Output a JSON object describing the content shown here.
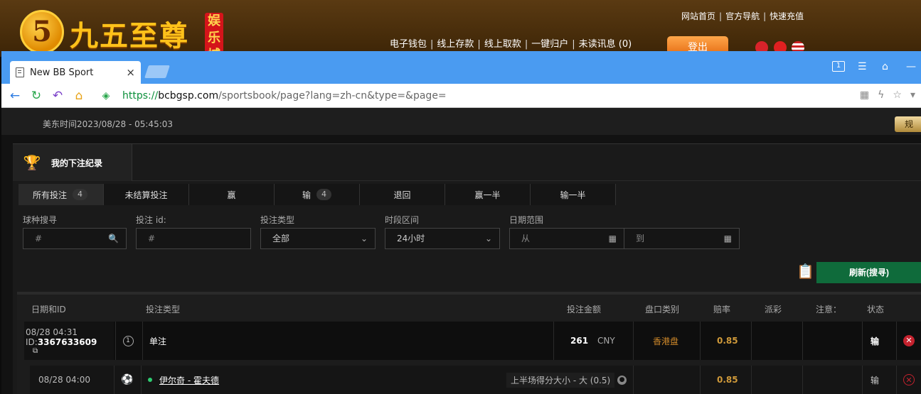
{
  "site": {
    "logo_numeral": "5",
    "logo_text": "九五至尊",
    "logo_badge": "娱乐城",
    "top_links": [
      "网站首页",
      "官方导航",
      "快速充值"
    ],
    "account_links": [
      "电子钱包",
      "线上存款",
      "线上取款",
      "一键归户",
      "未读讯息 (0)"
    ],
    "logout_label": "登出"
  },
  "browser": {
    "tab_title": "New BB Sport",
    "tab_close": "×",
    "url_scheme": "https://",
    "url_host": "bcbgsp.com",
    "url_path": "/sportsbook/page?lang=zh-cn&type=&page=",
    "window_badge": "1"
  },
  "page": {
    "us_east_time": "美东时间2023/08/28 - 05:45:03",
    "gold_button_label": "规",
    "panel_title": "我的下注纪录",
    "filter_tabs": [
      {
        "label": "所有投注",
        "count": "4"
      },
      {
        "label": "未结算投注",
        "count": ""
      },
      {
        "label": "赢",
        "count": ""
      },
      {
        "label": "输",
        "count": "4"
      },
      {
        "label": "退回",
        "count": ""
      },
      {
        "label": "赢一半",
        "count": ""
      },
      {
        "label": "输一半",
        "count": ""
      }
    ],
    "filters": {
      "sport_search": {
        "label": "球种搜寻",
        "placeholder": "#"
      },
      "bet_id": {
        "label": "投注 id:",
        "placeholder": "#"
      },
      "bet_type": {
        "label": "投注类型",
        "value": "全部"
      },
      "time_range": {
        "label": "时段区间",
        "value": "24小时"
      },
      "date_range": {
        "label": "日期范围",
        "from": "从",
        "to": "到"
      }
    },
    "refresh_label": "刷新(搜寻)",
    "table": {
      "headers": {
        "date_id": "日期和ID",
        "bet_type": "投注类型",
        "amount": "投注金额",
        "odds_type": "盘口类别",
        "odds": "赔率",
        "payout": "派彩",
        "note": "注意：",
        "status": "状态"
      },
      "row": {
        "datetime": "08/28 04:31",
        "id_label": "ID:",
        "id_value": "3367633609",
        "bet_type": "单注",
        "amount": "261",
        "currency": "CNY",
        "odds_type": "香港盘",
        "odds": "0.85",
        "status": "输"
      },
      "sub_row": {
        "datetime": "08/28 04:00",
        "match": "伊尔奇 - 霍夫德",
        "market": "上半场得分大小 - 大 (0.5)",
        "odds": "0.85",
        "status": "输"
      }
    }
  }
}
